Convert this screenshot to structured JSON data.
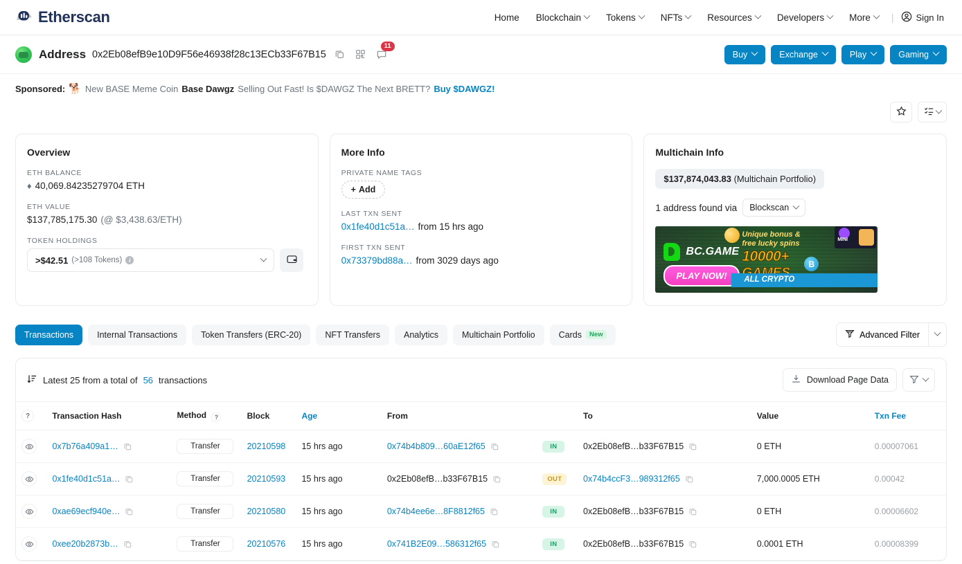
{
  "brand": {
    "name": "Etherscan"
  },
  "nav": {
    "items": [
      {
        "label": "Home",
        "caret": false
      },
      {
        "label": "Blockchain",
        "caret": true
      },
      {
        "label": "Tokens",
        "caret": true
      },
      {
        "label": "NFTs",
        "caret": true
      },
      {
        "label": "Resources",
        "caret": true
      },
      {
        "label": "Developers",
        "caret": true
      },
      {
        "label": "More",
        "caret": true
      }
    ],
    "divider": "|",
    "signin": "Sign In"
  },
  "address_header": {
    "title": "Address",
    "hash": "0x2Eb08efB9e10D9F56e46938f28c13ECb33F67B15",
    "chat_count": "11",
    "buttons": [
      {
        "label": "Buy"
      },
      {
        "label": "Exchange"
      },
      {
        "label": "Play"
      },
      {
        "label": "Gaming"
      }
    ]
  },
  "sponsored": {
    "label": "Sponsored:",
    "text_a": "New BASE Meme Coin",
    "bold_a": "Base Dawgz",
    "text_b": "Selling Out Fast! Is $DAWGZ The Next BRETT?",
    "cta": "Buy $DAWGZ!"
  },
  "overview": {
    "title": "Overview",
    "eth_balance_label": "ETH BALANCE",
    "eth_balance": "40,069.84235279704 ETH",
    "eth_value_label": "ETH VALUE",
    "eth_value": "$137,785,175.30",
    "eth_rate": "(@ $3,438.63/ETH)",
    "token_holdings_label": "TOKEN HOLDINGS",
    "token_value": ">$42.51",
    "token_count": "(>108 Tokens)"
  },
  "more_info": {
    "title": "More Info",
    "private_name_tags_label": "PRIVATE NAME TAGS",
    "add_label": "Add",
    "last_txn_label": "LAST TXN SENT",
    "last_txn_hash": "0x1fe40d1c51a…",
    "last_txn_age": "from 15 hrs ago",
    "first_txn_label": "FIRST TXN SENT",
    "first_txn_hash": "0x73379bd88a…",
    "first_txn_age": "from 3029 days ago"
  },
  "multichain": {
    "title": "Multichain Info",
    "portfolio_value": "$137,874,043.83",
    "portfolio_suffix": "(Multichain Portfolio)",
    "found_text": "1 address found via",
    "provider": "Blockscan",
    "ad": {
      "brand": "BC.GAME",
      "cta": "PLAY NOW!",
      "sub_line1": "Unique bonus &",
      "sub_line2": "free lucky spins",
      "big": "10000+",
      "big2": "GAMES",
      "bar": "ALL CRYPTO",
      "btc": "B",
      "mini": "MINI"
    }
  },
  "tabs": [
    {
      "label": "Transactions",
      "active": true,
      "badge": ""
    },
    {
      "label": "Internal Transactions",
      "active": false,
      "badge": ""
    },
    {
      "label": "Token Transfers (ERC-20)",
      "active": false,
      "badge": ""
    },
    {
      "label": "NFT Transfers",
      "active": false,
      "badge": ""
    },
    {
      "label": "Analytics",
      "active": false,
      "badge": ""
    },
    {
      "label": "Multichain Portfolio",
      "active": false,
      "badge": ""
    },
    {
      "label": "Cards",
      "active": false,
      "badge": "New"
    }
  ],
  "advanced_filter": {
    "label": "Advanced Filter"
  },
  "table_panel": {
    "latest_prefix": "Latest 25 from a total of",
    "total": "56",
    "latest_suffix": "transactions",
    "download_label": "Download Page Data",
    "columns": [
      {
        "label": "",
        "accent": false
      },
      {
        "label": "Transaction Hash",
        "accent": false
      },
      {
        "label": "Method",
        "accent": false
      },
      {
        "label": "Block",
        "accent": false
      },
      {
        "label": "Age",
        "accent": true
      },
      {
        "label": "From",
        "accent": false
      },
      {
        "label": "",
        "accent": false
      },
      {
        "label": "To",
        "accent": false
      },
      {
        "label": "Value",
        "accent": false
      },
      {
        "label": "Txn Fee",
        "accent": true
      }
    ],
    "rows": [
      {
        "hash": "0x7b76a409a1…",
        "method": "Transfer",
        "block": "20210598",
        "age": "15 hrs ago",
        "from": "0x74b4b809…60aE12f65",
        "from_link": true,
        "direction": "IN",
        "to": "0x2Eb08efB…b33F67B15",
        "to_link": false,
        "value": "0 ETH",
        "fee": "0.00007061"
      },
      {
        "hash": "0x1fe40d1c51a…",
        "method": "Transfer",
        "block": "20210593",
        "age": "15 hrs ago",
        "from": "0x2Eb08efB…b33F67B15",
        "from_link": false,
        "direction": "OUT",
        "to": "0x74b4ccF3…989312f65",
        "to_link": true,
        "value": "7,000.0005 ETH",
        "fee": "0.00042"
      },
      {
        "hash": "0xae69ecf940e…",
        "method": "Transfer",
        "block": "20210580",
        "age": "15 hrs ago",
        "from": "0x74b4ee6e…8F8812f65",
        "from_link": true,
        "direction": "IN",
        "to": "0x2Eb08efB…b33F67B15",
        "to_link": false,
        "value": "0 ETH",
        "fee": "0.00006602"
      },
      {
        "hash": "0xee20b2873b…",
        "method": "Transfer",
        "block": "20210576",
        "age": "15 hrs ago",
        "from": "0x741B2E09…586312f65",
        "from_link": true,
        "direction": "IN",
        "to": "0x2Eb08efB…b33F67B15",
        "to_link": false,
        "value": "0.0001 ETH",
        "fee": "0.00008399"
      }
    ]
  },
  "colors": {
    "accent": "#0784c3",
    "in_badge": "#1a9e63",
    "out_badge": "#c99a12",
    "danger": "#dc3545"
  }
}
